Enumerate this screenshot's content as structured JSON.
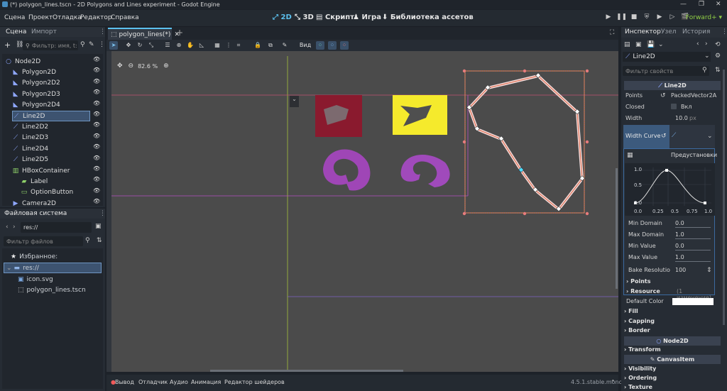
{
  "window": {
    "title": "(*) polygon_lines.tscn - 2D Polygons and Lines experiment - Godot Engine"
  },
  "menu": [
    "Сцена",
    "Проект",
    "Отладка",
    "Редактор",
    "Справка"
  ],
  "workspaces": {
    "w2d": "2D",
    "w3d": "3D",
    "script": "Скрипт",
    "game": "Игра",
    "assets": "Библиотека ассетов"
  },
  "renderer": "Forward+",
  "scene_dock": {
    "tab_scene": "Сцена",
    "tab_import": "Импорт",
    "filter_placeholder": "Фильтр: имя, t:",
    "nodes": [
      {
        "label": "Node2D",
        "icon": "node2d-icon",
        "indent": 0
      },
      {
        "label": "Polygon2D",
        "icon": "polygon2d-icon",
        "indent": 1
      },
      {
        "label": "Polygon2D2",
        "icon": "polygon2d-icon",
        "indent": 1
      },
      {
        "label": "Polygon2D3",
        "icon": "polygon2d-icon",
        "indent": 1
      },
      {
        "label": "Polygon2D4",
        "icon": "polygon2d-icon",
        "indent": 1
      },
      {
        "label": "Line2D",
        "icon": "line2d-icon",
        "indent": 1,
        "selected": true
      },
      {
        "label": "Line2D2",
        "icon": "line2d-icon",
        "indent": 1
      },
      {
        "label": "Line2D3",
        "icon": "line2d-icon",
        "indent": 1
      },
      {
        "label": "Line2D4",
        "icon": "line2d-icon",
        "indent": 1
      },
      {
        "label": "Line2D5",
        "icon": "line2d-icon",
        "indent": 1
      },
      {
        "label": "HBoxContainer",
        "icon": "hbox-icon",
        "indent": 1
      },
      {
        "label": "Label",
        "icon": "label-icon",
        "indent": 2
      },
      {
        "label": "OptionButton",
        "icon": "optionbutton-icon",
        "indent": 2
      },
      {
        "label": "Camera2D",
        "icon": "camera-icon",
        "indent": 1
      }
    ]
  },
  "filesystem": {
    "title": "Файловая система",
    "path": "res://",
    "filter_placeholder": "Фильтр файлов",
    "favorites": "Избранное:",
    "items": [
      {
        "label": "res://",
        "selected": true
      },
      {
        "label": "icon.svg"
      },
      {
        "label": "polygon_lines.tscn"
      }
    ]
  },
  "editor": {
    "tab": "polygon_lines(*)",
    "zoom": "82.6 %",
    "view_menu": "Вид"
  },
  "bottom": {
    "output": "Вывод",
    "debugger": "Отладчик",
    "audio": "Аудио",
    "animation": "Анимация",
    "shader": "Редактор шейдеров",
    "version": "4.5.1.stable.mono"
  },
  "inspector": {
    "tab_inspector": "Инспектор",
    "tab_node": "Узел",
    "tab_history": "История",
    "node_name": "Line2D",
    "filter_placeholder": "Фильтр свойств",
    "class_title": "Line2D",
    "points_label": "Points",
    "points_value": "PackedVector2A",
    "closed_label": "Closed",
    "closed_value": "Вкл",
    "width_label": "Width",
    "width_value": "10.0",
    "width_unit": "px",
    "width_curve_label": "Width Curve",
    "presets": "Предустановки",
    "curve_y_labels": [
      "1.0",
      "0.5",
      "0.0"
    ],
    "curve_x_labels": [
      "0.0",
      "0.25",
      "0.5",
      "0.75",
      "1.0"
    ],
    "min_domain_label": "Min Domain",
    "min_domain": "0.0",
    "max_domain_label": "Max Domain",
    "max_domain": "1.0",
    "min_value_label": "Min Value",
    "min_value": "0.0",
    "max_value_label": "Max Value",
    "max_value": "1.0",
    "bake_label": "Bake Resolutio",
    "bake_value": "100",
    "points_section": "Points",
    "resource_section": "Resource",
    "resource_changes": "(1 изменение)",
    "default_color_label": "Default Color",
    "default_color": "#ffffff",
    "fill": "Fill",
    "capping": "Capping",
    "border": "Border",
    "node2d": "Node2D",
    "transform": "Transform",
    "canvasitem": "CanvasItem",
    "visibility": "Visibility",
    "ordering": "Ordering",
    "texture": "Texture"
  },
  "colors": {
    "accent": "#5cc1ef",
    "forward": "#8fcd44",
    "line_selected": "#e07a5f",
    "canvas": "#4b4b4b"
  }
}
